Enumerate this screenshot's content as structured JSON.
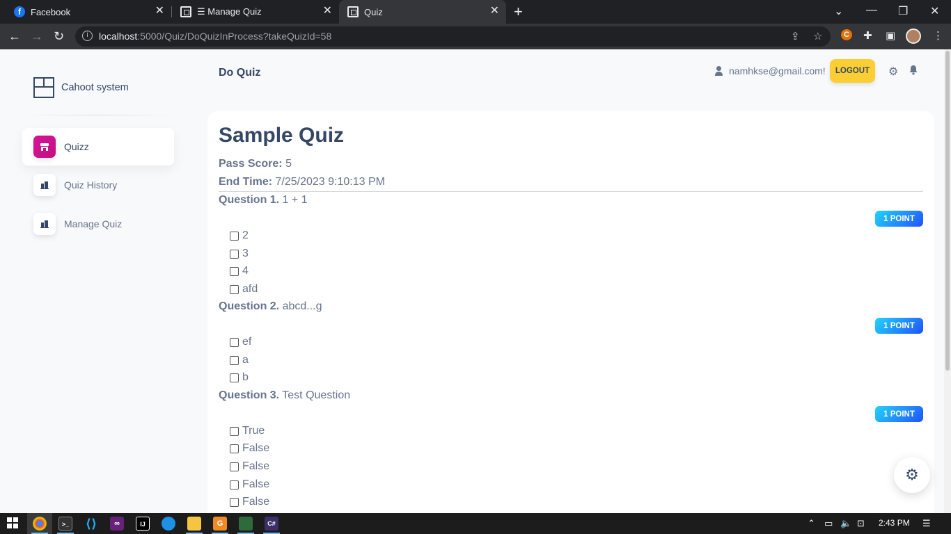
{
  "browser": {
    "tabs": [
      {
        "label": "Facebook",
        "icon": "facebook-icon"
      },
      {
        "label": "☰ Manage Quiz",
        "icon": "quiz-app-icon"
      },
      {
        "label": "Quiz",
        "icon": "quiz-app-icon"
      }
    ],
    "url_host": "localhost",
    "url_path": ":5000/Quiz/DoQuizInProcess?takeQuizId=58"
  },
  "sidebar": {
    "brand": "Cahoot system",
    "items": [
      {
        "label": "Quizz",
        "active": true
      },
      {
        "label": "Quiz History",
        "active": false
      },
      {
        "label": "Manage Quiz",
        "active": false
      }
    ]
  },
  "header": {
    "title": "Do Quiz",
    "user_email": "namhkse@gmail.com!",
    "logout_label": "LOGOUT"
  },
  "quiz": {
    "title": "Sample Quiz",
    "pass_score_label": "Pass Score:",
    "pass_score": "5",
    "end_time_label": "End Time:",
    "end_time": "7/25/2023 9:10:13 PM",
    "questions": [
      {
        "number": "Question 1.",
        "text": "1 + 1",
        "points": "1 POINT",
        "options": [
          "2",
          "3",
          "4",
          "afd"
        ]
      },
      {
        "number": "Question 2.",
        "text": "abcd...g",
        "points": "1 POINT",
        "options": [
          "ef",
          "a",
          "b"
        ]
      },
      {
        "number": "Question 3.",
        "text": "Test Question",
        "points": "1 POINT",
        "options": [
          "True",
          "False",
          "False",
          "False",
          "False"
        ]
      }
    ]
  },
  "taskbar": {
    "time": "2:43 PM"
  },
  "colors": {
    "accent": "#cb0c9f",
    "badge_start": "#21d4fd",
    "badge_end": "#2152ff",
    "logout": "#fbcf33",
    "text_dark": "#344767",
    "text_muted": "#67748e"
  }
}
